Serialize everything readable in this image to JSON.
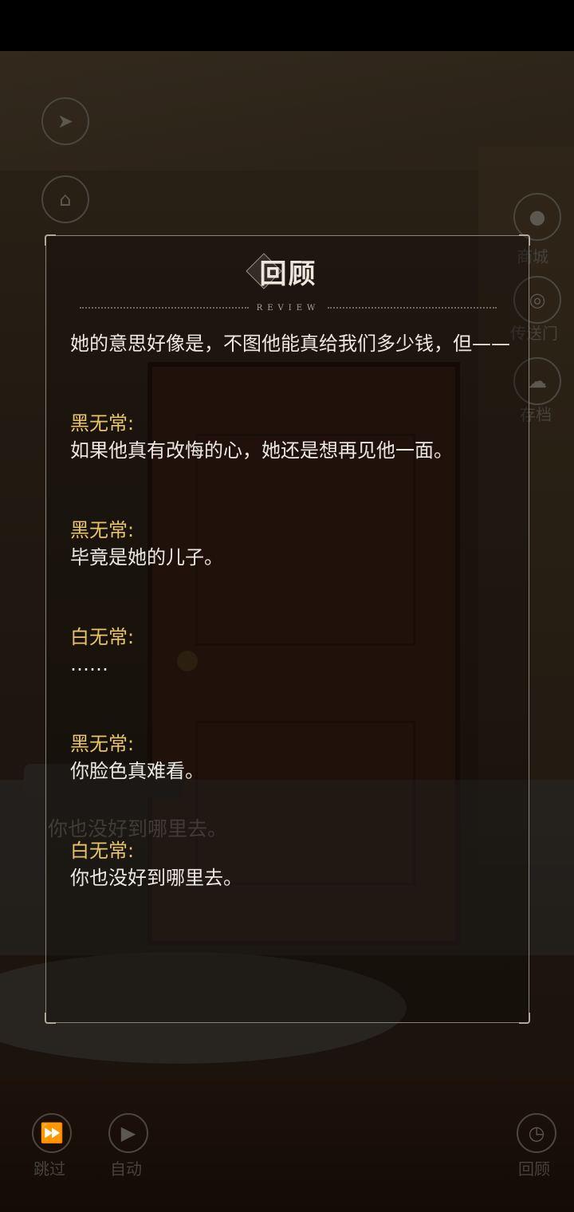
{
  "background": {
    "underlying_dialog_text": "你也没好到哪里去。",
    "side_buttons": {
      "mall_label": "商城",
      "portal_label": "传送门",
      "save_label": "存档",
      "skip_label": "跳过",
      "auto_label": "自动",
      "review_label": "回顾"
    }
  },
  "review": {
    "title": "回顾",
    "subtitle": "REVIEW",
    "entries": [
      {
        "speaker": "",
        "text": "她的意思好像是，不图他能真给我们多少钱，但——"
      },
      {
        "speaker": "黑无常:",
        "text": "如果他真有改悔的心，她还是想再见他一面。"
      },
      {
        "speaker": "黑无常:",
        "text": "毕竟是她的儿子。"
      },
      {
        "speaker": "白无常:",
        "text": "……"
      },
      {
        "speaker": "黑无常:",
        "text": "你脸色真难看。"
      },
      {
        "speaker": "白无常:",
        "text": "你也没好到哪里去。"
      }
    ]
  },
  "colors": {
    "speaker": "#e8c468",
    "text": "#ece8e2",
    "panel_border": "#8a8478"
  }
}
